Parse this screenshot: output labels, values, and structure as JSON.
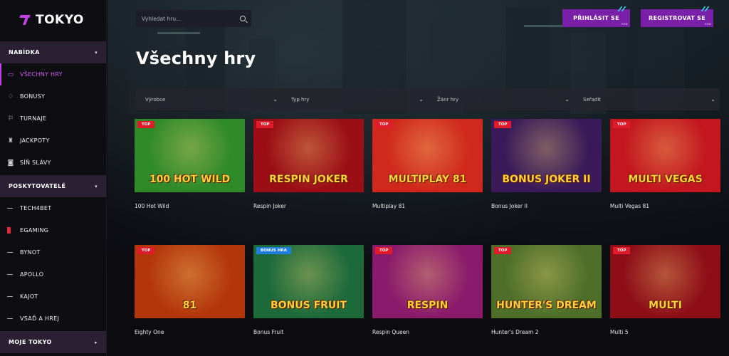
{
  "brand": "TOKYO",
  "sidebar": {
    "sections": [
      {
        "label": "NABÍDKA"
      },
      {
        "label": "POSKYTOVATELÉ"
      },
      {
        "label": "MOJE TOKYO"
      }
    ],
    "menu": [
      {
        "label": "VŠECHNY HRY",
        "icon": "controller-icon"
      },
      {
        "label": "BONUSY",
        "icon": "diamond-icon"
      },
      {
        "label": "TURNAJE",
        "icon": "flag-icon"
      },
      {
        "label": "JACKPOTY",
        "icon": "cup-icon"
      },
      {
        "label": "SÍŇ SLÁVY",
        "icon": "camera-icon"
      }
    ],
    "providers": [
      "TECH4BET",
      "EGAMING",
      "BYNOT",
      "APOLLO",
      "KAJOT",
      "VSAĎ A HREJ"
    ]
  },
  "header": {
    "search_placeholder": "Vyhledat hru...",
    "login_label": "PŘIHLÁSIT SE",
    "register_label": "REGISTROVAT SE",
    "btn_tag": "new"
  },
  "main": {
    "title": "Všechny hry",
    "filters": [
      "Výrobce",
      "Typ hry",
      "Žánr hry",
      "Seřadit"
    ]
  },
  "games": [
    {
      "name": "100 Hot Wild",
      "badge": "TOP",
      "art": "100 HOT WILD",
      "bg": "#2f8a2a"
    },
    {
      "name": "Respin Joker",
      "badge": "TOP",
      "art": "RESPIN JOKER",
      "bg": "#9b0e16"
    },
    {
      "name": "Multiplay 81",
      "badge": "TOP",
      "art": "MULTIPLAY 81",
      "bg": "#d0281c"
    },
    {
      "name": "Bonus Joker II",
      "badge": "TOP",
      "art": "BONUS JOKER II",
      "bg": "#3b1a5a"
    },
    {
      "name": "Multi Vegas 81",
      "badge": "TOP",
      "art": "MULTI VEGAS",
      "bg": "#c3161e"
    },
    {
      "name": "Eighty One",
      "badge": "TOP",
      "art": "81",
      "bg": "#b3350a"
    },
    {
      "name": "Bonus Fruit",
      "badge": "BONUS HRA",
      "art": "BONUS FRUIT",
      "bg": "#1c6a3a"
    },
    {
      "name": "Respin Queen",
      "badge": "TOP",
      "art": "RESPIN",
      "bg": "#8a1a6c"
    },
    {
      "name": "Hunter's Dream 2",
      "badge": "TOP",
      "art": "HUNTER'S DREAM",
      "bg": "#4d6f2a"
    },
    {
      "name": "Multi 5",
      "badge": "TOP",
      "art": "MULTI",
      "bg": "#8e0e18"
    }
  ]
}
